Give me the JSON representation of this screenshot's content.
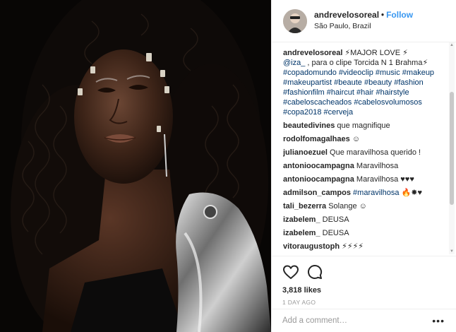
{
  "post": {
    "author": "andrevelosoreal",
    "follow_label": "Follow",
    "separator": "•",
    "location": "São Paulo, Brazil",
    "caption": {
      "user": "andrevelosoreal",
      "text_1": " ⚡MAJOR LOVE ⚡",
      "mention": "@iza_",
      "text_2": " , para o clipe Torcida N 1 Brahma⚡",
      "hashtags": [
        "#copadomundo",
        "#videoclip",
        "#music",
        "#makeup",
        "#makeupartist",
        "#beaute",
        "#beauty",
        "#fashion",
        "#fashionfilm",
        "#haircut",
        "#hair",
        "#hairstyle",
        "#cabeloscacheados",
        "#cabelosvolumosos",
        "#copa2018",
        "#cerveja"
      ]
    },
    "comments": [
      {
        "user": "beautedivines",
        "text": "que magnifique"
      },
      {
        "user": "rodolfomagalhaes",
        "text": "☺"
      },
      {
        "user": "julianoezuel",
        "text": "Que maravilhosa querido !"
      },
      {
        "user": "antonioocampagna",
        "text": "Maravilhosa"
      },
      {
        "user": "antonioocampagna",
        "text": "Maravilhosa ♥♥♥"
      },
      {
        "user": "admilson_campos",
        "tag": "#maravilhosa",
        "text": "🔥✸♥"
      },
      {
        "user": "tali_bezerra",
        "text": "Solange ☺"
      },
      {
        "user": "izabelem_",
        "text": "DEUSA"
      },
      {
        "user": "izabelem_",
        "text": "DEUSA"
      },
      {
        "user": "vitoraugustoph",
        "text": "⚡⚡⚡⚡"
      }
    ],
    "likes": "3,818 likes",
    "time_ago": "1 DAY AGO",
    "add_comment_placeholder": "Add a comment…",
    "more_label": "•••"
  },
  "icons": {
    "like": "heart-icon",
    "comment": "comment-bubble-icon"
  },
  "colors": {
    "link": "#3897f0",
    "hashtag": "#003569",
    "text": "#262626",
    "muted": "#999999"
  }
}
